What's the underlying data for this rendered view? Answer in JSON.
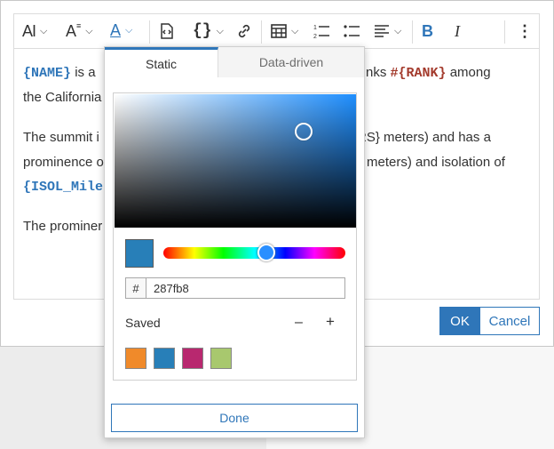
{
  "toolbar": {
    "font_size_icon": "AI",
    "font_style_icon": "A",
    "font_color_icon": "A",
    "insert_template_icon": "document-code-icon",
    "insert_field_icon": "{}",
    "link_icon": "link-icon",
    "table_icon": "table-icon",
    "numbered_list_icon": "numbered-list-icon",
    "bullet_list_icon": "bullet-list-icon",
    "align_icon": "align-icon",
    "bold_label": "B",
    "italic_label": "I",
    "more_icon": "⋮",
    "accent_color": "#2f76b9"
  },
  "editor": {
    "p1_field_name": "{NAME}",
    "p1_text1": "is a",
    "p1_text2": "nks",
    "p1_field_rank": "#{RANK}",
    "p1_text3": "among",
    "p1_line2": "the California",
    "p2_line1": "The summit i",
    "p2_text1": "RS} meters) and has a",
    "p2_line2": "prominence o",
    "p2_text2": "meters) and isolation of",
    "p2_field_isol": "{ISOL_Miles",
    "p3_line1": "The prominer"
  },
  "popover": {
    "tabs": [
      "Static",
      "Data-driven"
    ],
    "selected_tab": "Static",
    "current_color": "#287fb8",
    "hex_prefix": "#",
    "hex_value": "287fb8",
    "saved_label": "Saved",
    "minus_label": "–",
    "plus_label": "+",
    "saved_colors": [
      "#f08a2a",
      "#287fb8",
      "#b8286f",
      "#a8c86e"
    ],
    "done_label": "Done"
  },
  "dialog": {
    "ok_label": "OK",
    "cancel_label": "Cancel"
  }
}
